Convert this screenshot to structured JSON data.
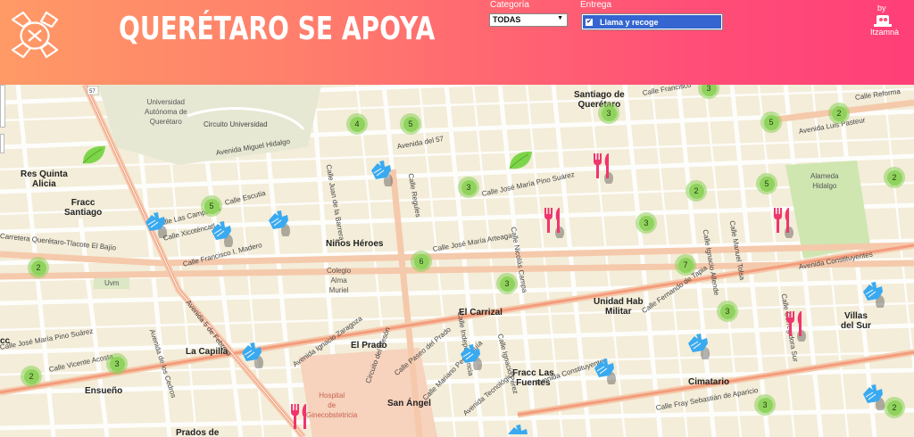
{
  "header": {
    "title": "QUERÉTARO SE APOYA",
    "category_label": "Categoría",
    "category_value": "TODAS",
    "delivery_label": "Entrega",
    "delivery_option": "Llama y recoge",
    "by_label": "by",
    "brand": "Itzamnà"
  },
  "colors": {
    "header_gradient_start": "#ff9a66",
    "header_gradient_end": "#ff3f78",
    "cluster": "#8fd35d",
    "hand_marker": "#3aaaf0",
    "food_marker": "#f0356e",
    "leaf_marker": "#7dd64a"
  },
  "map": {
    "places": [
      {
        "text": "Res Quinta\nAlicia",
        "cls": ""
      },
      {
        "text": "Fracc\nSantiago",
        "cls": ""
      },
      {
        "text": "Niños Héroes",
        "cls": ""
      },
      {
        "text": "Santiago de\nQuerétaro",
        "cls": ""
      },
      {
        "text": "El Carrizal",
        "cls": ""
      },
      {
        "text": "Unidad Hab\nMilitar",
        "cls": ""
      },
      {
        "text": "El Prado",
        "cls": ""
      },
      {
        "text": "La Capilla",
        "cls": ""
      },
      {
        "text": "Ensueño",
        "cls": ""
      },
      {
        "text": "Fracc Las\nFuentes",
        "cls": ""
      },
      {
        "text": "Cimatario",
        "cls": ""
      },
      {
        "text": "Villas\ndel Sur",
        "cls": ""
      },
      {
        "text": "San Ángel",
        "cls": ""
      },
      {
        "text": "Prados de",
        "cls": ""
      },
      {
        "text": "Universidad\nAutónoma de\nQuerétaro",
        "cls": "small"
      },
      {
        "text": "Colegio\nAlma\nMuriel",
        "cls": "small"
      },
      {
        "text": "Hospital\nde\nGinecobstetricia",
        "cls": "small red"
      },
      {
        "text": "Uvm",
        "cls": "small"
      },
      {
        "text": "Alameda\nHidalgo",
        "cls": "small"
      },
      {
        "text": "cc",
        "cls": ""
      }
    ],
    "streets": [
      "Avenida Miguel Hidalgo",
      "Circuito Universidad",
      "Avenida del 57",
      "Calle José María Pino Suárez",
      "Calle José María Arteaga",
      "Avenida Ignacio Zaragoza",
      "Carretera Querétaro-Tlacote El Bajío",
      "Calle Francisco I. Madero",
      "Calle Xicoténcatl",
      "Avenida 5 de Febrero",
      "Calle José María Pino Suárez",
      "Calle Vicente Acosta",
      "Avenida Constituyentes",
      "Avenida Constituyentes",
      "Calle Ignacio Allende",
      "Calle Manuel Tolsa",
      "Calle Fernando de Tapia",
      "Circuito del Mesón",
      "Calle Paseo del Prado",
      "Avenida Tecnológico",
      "Calle Nicolás Campa",
      "Calle Reforma",
      "Avenida Luis Pasteur",
      "Calle Francisco",
      "Calle Fray Sebastián de Aparicio",
      "Calle Ignacio Pérez",
      "Calle Mariano Perrusquía",
      "Calle Regules",
      "Calle Juan de la Barrera",
      "Calle Escutia",
      "Calle Corregidora Sur",
      "Calle Las Campanas",
      "Avenida de los Cedros",
      "Calle Independencia"
    ],
    "clusters": [
      "4",
      "5",
      "5",
      "3",
      "3",
      "5",
      "2",
      "2",
      "3",
      "2",
      "3",
      "6",
      "3",
      "7",
      "5",
      "2",
      "2",
      "3",
      "3",
      "2",
      "3",
      "3",
      "2"
    ]
  }
}
